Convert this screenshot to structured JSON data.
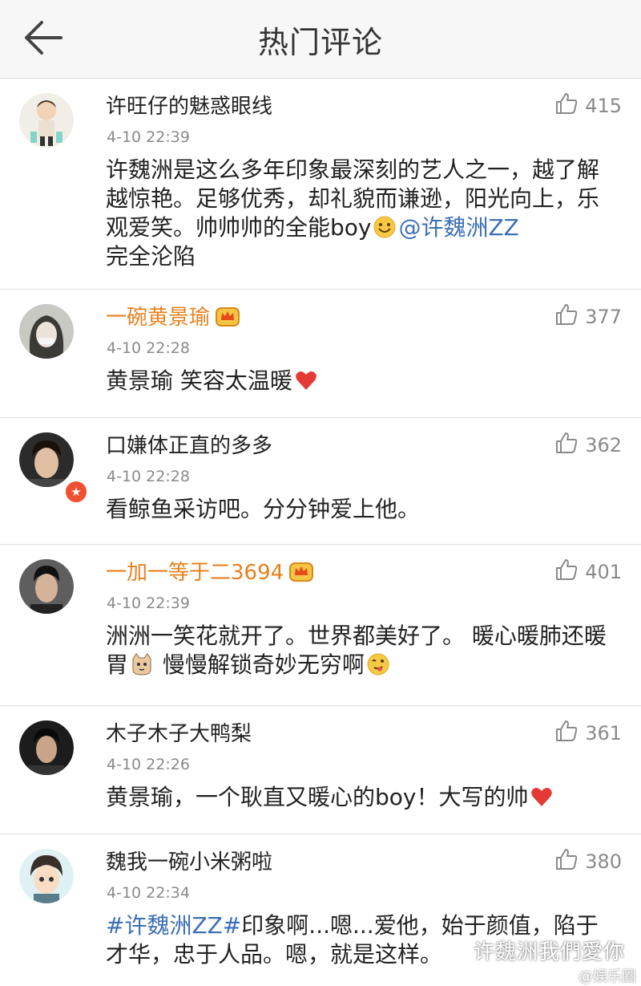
{
  "header": {
    "title": "热门评论"
  },
  "colors": {
    "vip_name": "#e8801c",
    "mention": "#3c6fb6",
    "heart": "#e53935"
  },
  "comments": [
    {
      "username": "许旺仔的魅惑眼线",
      "time": "4-10 22:39",
      "likes": "415",
      "text_a": "许魏洲是这么多年印象最深刻的艺人之一，越了解越惊艳。足够优秀，却礼貌而谦逊，阳光向上，乐观爱笑。帅帅帅的全能boy",
      "mention": "@许魏洲ZZ",
      "text_b": "完全沦陷",
      "emoji": "smile-emoji"
    },
    {
      "username": "一碗黄景瑜",
      "time": "4-10 22:28",
      "likes": "377",
      "text": "黄景瑜 笑容太温暖",
      "emoji": "heart-emoji"
    },
    {
      "username": "口嫌体正直的多多",
      "time": "4-10 22:28",
      "likes": "362",
      "text": "看鲸鱼采访吧。分分钟爱上他。"
    },
    {
      "username": "一加一等于二3694",
      "time": "4-10 22:39",
      "likes": "401",
      "text_a": "洲洲一笑花就开了。世界都美好了。 暖心暖肺还暖胃",
      "text_b": "慢慢解锁奇妙无穷啊"
    },
    {
      "username": "木子木子大鸭梨",
      "time": "4-10 22:26",
      "likes": "361",
      "text": "黄景瑜，一个耿直又暖心的boy！大写的帅"
    },
    {
      "username": "魏我一碗小米粥啦",
      "time": "4-10 22:34",
      "likes": "380",
      "hashtag": "#许魏洲ZZ#",
      "text": "印象啊...嗯...爱他，始于颜值，陷于才华，忠于人品。嗯，就是这样。"
    }
  ],
  "watermark": "许魏洲我們愛你",
  "watermark_small": "@娱乐圈"
}
